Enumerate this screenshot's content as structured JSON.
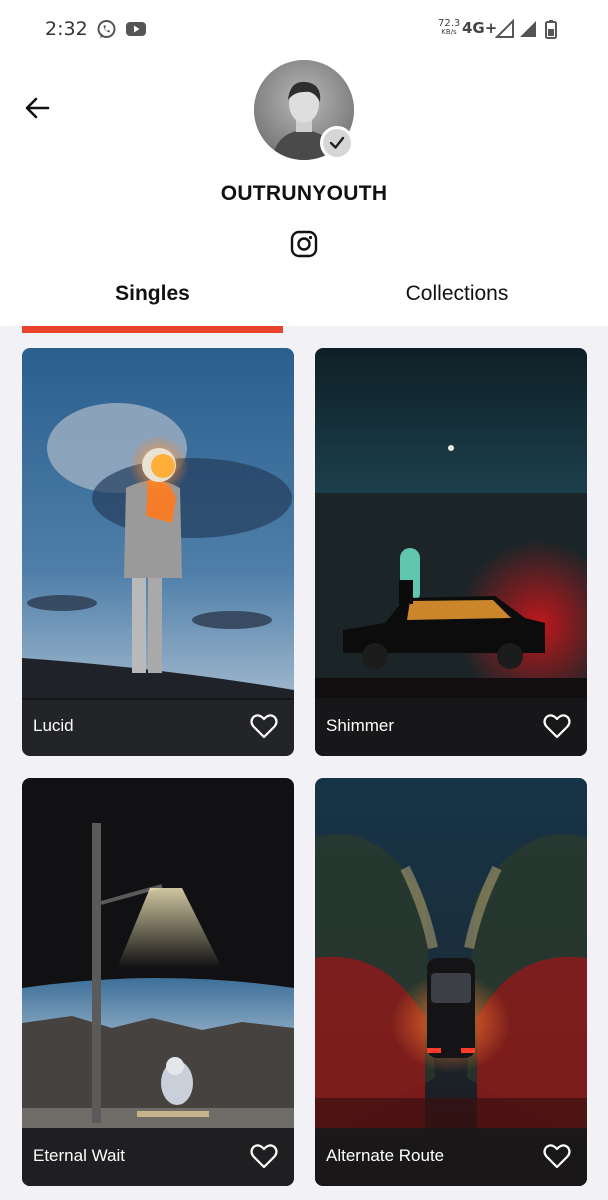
{
  "status_bar": {
    "time": "2:32",
    "speed_value": "72.3",
    "speed_unit": "KB/s",
    "network": "4G+",
    "icons": [
      "whatsapp-icon",
      "youtube-icon",
      "signal-icon",
      "signal-icon",
      "battery-icon"
    ]
  },
  "profile": {
    "name": "OUTRUNYOUTH",
    "verified": true,
    "social_icon": "instagram-icon"
  },
  "tabs": [
    {
      "label": "Singles",
      "active": true
    },
    {
      "label": "Collections",
      "active": false
    }
  ],
  "accent_color": "#e8432a",
  "cards": [
    {
      "title": "Lucid",
      "icon": "heart-icon"
    },
    {
      "title": "Shimmer",
      "icon": "heart-icon"
    },
    {
      "title": "Eternal Wait",
      "icon": "heart-icon"
    },
    {
      "title": "Alternate Route",
      "icon": "heart-icon"
    }
  ]
}
